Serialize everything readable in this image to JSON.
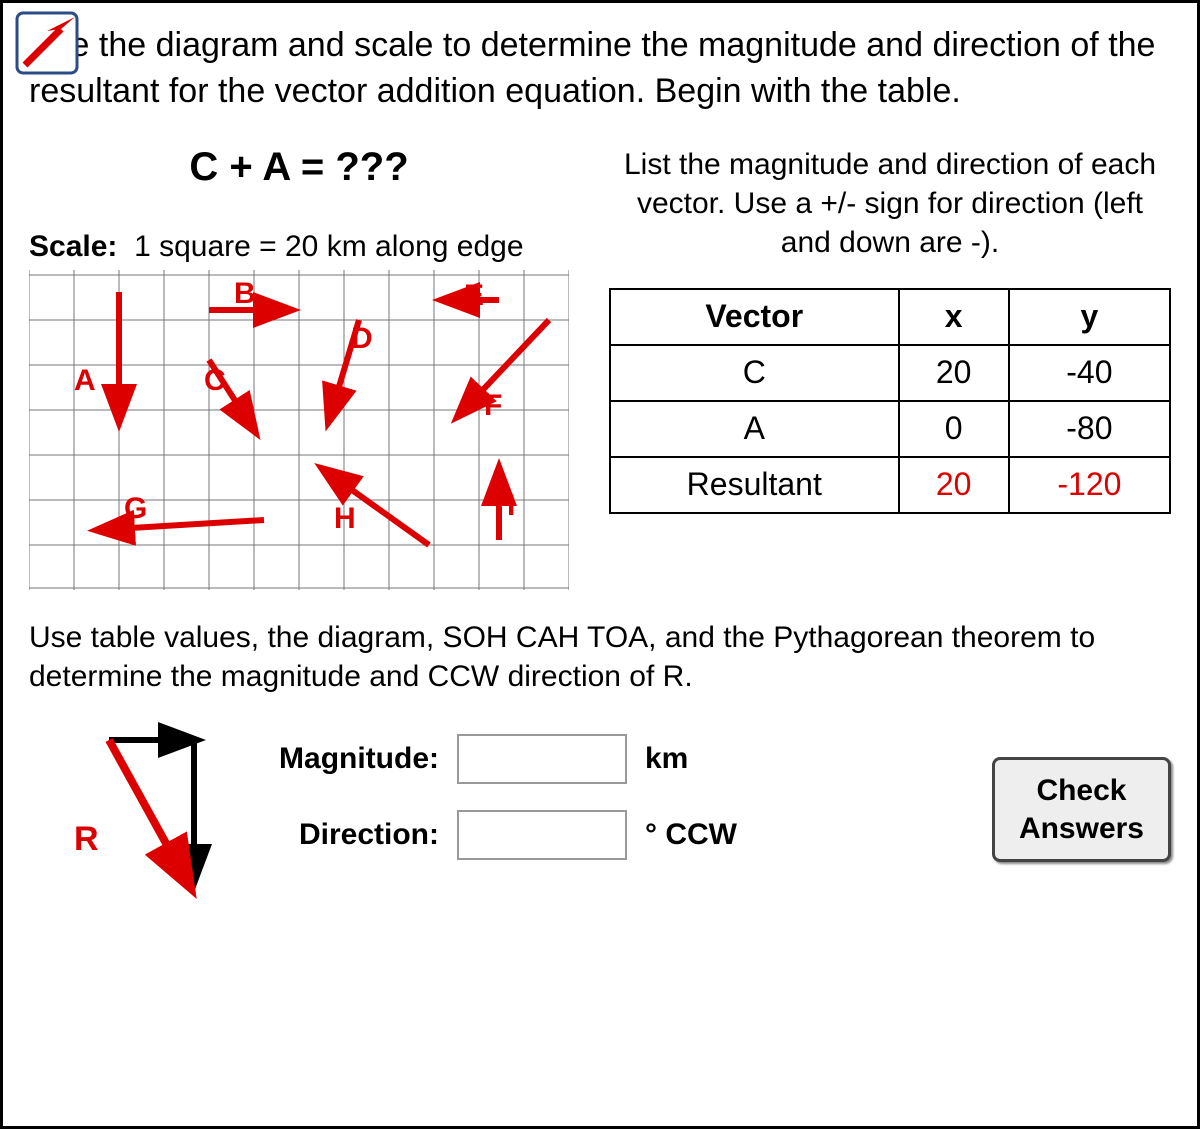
{
  "intro": "Use the diagram and scale to determine the magnitude and direction of the resultant for the vector addition equation. Begin with the table.",
  "equation": "C + A = ???",
  "scale_label": "Scale:",
  "scale_text": "1 square = 20 km along edge",
  "list_note": "List the magnitude and direction of each vector. Use a +/- sign for direction (left and down are -).",
  "table": {
    "headers": {
      "col0": "Vector",
      "col1": "x",
      "col2": "y"
    },
    "rows": [
      {
        "name": "C",
        "x": "20",
        "y": "-40",
        "isResult": false
      },
      {
        "name": "A",
        "x": "0",
        "y": "-80",
        "isResult": false
      },
      {
        "name": "Resultant",
        "x": "20",
        "y": "-120",
        "isResult": true
      }
    ]
  },
  "vectors_in_grid": [
    "A",
    "B",
    "C",
    "D",
    "E",
    "F",
    "G",
    "H",
    "I"
  ],
  "below_text": "Use table values, the diagram, SOH CAH TOA, and the Pythagorean theorem to determine the magnitude and CCW direction of R.",
  "answer": {
    "mag_label": "Magnitude:",
    "mag_unit": "km",
    "dir_label": "Direction:",
    "dir_unit": "° CCW"
  },
  "check_button_line1": "Check",
  "check_button_line2": "Answers",
  "r_label": "R"
}
